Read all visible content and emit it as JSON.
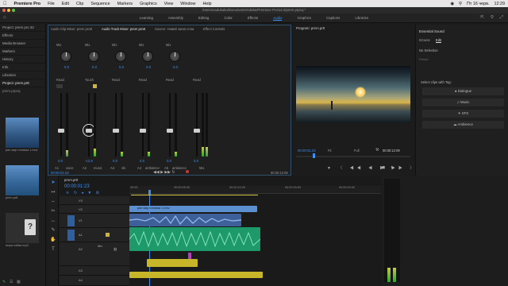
{
  "menubar": {
    "app": "Premiere Pro",
    "items": [
      "File",
      "Edit",
      "Clip",
      "Sequence",
      "Markers",
      "Graphics",
      "View",
      "Window",
      "Help"
    ],
    "datetime": "Пт 16 черв.",
    "time": "12:29"
  },
  "titlebar": {
    "path": "/Users/vadukuku/Documents/Adobe/Premiere Pro/14.0/prem.prproj *"
  },
  "workspaces": [
    "Learning",
    "Assembly",
    "Editing",
    "Color",
    "Effects",
    "Audio",
    "Graphics",
    "Captions",
    "Libraries"
  ],
  "workspace_active": "Audio",
  "left_panel": {
    "items": [
      "Project: prem pro 32",
      "Effects",
      "Media Browser",
      "Markers",
      "History",
      "Info",
      "Libraries"
    ],
    "project_title": "Project: prem.pr8",
    "project_file": "prem.prproj",
    "thumb_labels": [
      "рип мир готовим 1.mov",
      "prem.pr8",
      "мора лайки.mp3"
    ]
  },
  "mixer": {
    "tabs": [
      "Audio Clip Mixer: prem pro8",
      "Audio Track Mixer: prem pro8",
      "Source: Новий запис.m4a",
      "Effect Controls"
    ],
    "sends": [
      "Mix",
      "Mix",
      "Mix",
      "Mix",
      "Mix"
    ],
    "automation": [
      "Read",
      "Touch",
      "Read",
      "Read",
      "Read"
    ],
    "pan_values": [
      "0.0",
      "0.0",
      "0.0",
      "0.0",
      "0.0"
    ],
    "db_values": [
      "0.0",
      "-12.9",
      "0.0",
      "0.0",
      "0.0",
      "0.0"
    ],
    "channels": [
      {
        "id": "A1",
        "name": "voice"
      },
      {
        "id": "A2",
        "name": "music"
      },
      {
        "id": "A3",
        "name": "sfx"
      },
      {
        "id": "A4",
        "name": "ambience"
      },
      {
        "id": "A5",
        "name": "ambience"
      },
      {
        "id": "Mix",
        "name": "Mix"
      }
    ],
    "timecode_left": "00:00:01:23",
    "timecode_right": "00:00:12:09"
  },
  "program": {
    "title": "Program: prem.pr8",
    "timecode": "00:00:01:23",
    "fit": "Fit",
    "quality": "Full",
    "duration": "00:00:12:09"
  },
  "essential_sound": {
    "title": "Essential Sound",
    "tabs": [
      "Browse",
      "Edit"
    ],
    "no_selection": "No Selection",
    "preset_label": "Preset",
    "tag_label": "Select clips with Tag:",
    "buttons": [
      "Dialogue",
      "Music",
      "SFX",
      "Ambience"
    ]
  },
  "timeline": {
    "sequence": "prem.pr8",
    "timecode": "00:00:01:23",
    "ruler": [
      "00:00",
      "00:00:05:00",
      "00:00:10:00",
      "00:00:15:00",
      "00:00:20:00"
    ],
    "video_tracks": [
      "V3",
      "V2",
      "V1"
    ],
    "audio_tracks": [
      "A1",
      "A2",
      "A3",
      "A4",
      "A5"
    ],
    "video_clip": "рип мир готовим 1.mov",
    "mix_label": "Mix"
  },
  "colors": {
    "accent": "#3d8ff0",
    "clip_video": "#5b8fd0",
    "clip_audio_blue": "#3d5f9a",
    "clip_audio_green": "#1e9a6a",
    "clip_audio_yellow": "#c7b62a",
    "meter_green": "#2fa52f"
  }
}
